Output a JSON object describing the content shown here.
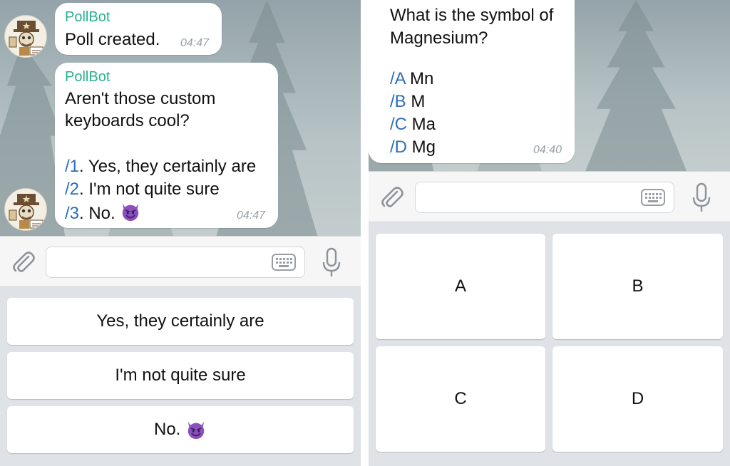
{
  "left": {
    "messages": [
      {
        "sender": "PollBot",
        "lines": [
          "Poll created."
        ],
        "time": "04:47"
      },
      {
        "sender": "PollBot",
        "question_lines": [
          "Aren't those custom",
          "keyboards cool?"
        ],
        "options": [
          {
            "cmd": "/1",
            "text": ". Yes, they certainly are"
          },
          {
            "cmd": "/2",
            "text": ". I'm not quite sure"
          },
          {
            "cmd": "/3",
            "text": ". No. ",
            "emoji": "smiling-imp"
          }
        ],
        "time": "04:47"
      }
    ],
    "keyboard": [
      {
        "label": "Yes, they certainly are"
      },
      {
        "label": "I'm not quite sure"
      },
      {
        "label": "No. ",
        "emoji": "smiling-imp"
      }
    ]
  },
  "right": {
    "message": {
      "question_lines": [
        "What is the symbol of",
        "Magnesium?"
      ],
      "options": [
        {
          "cmd": "/A",
          "text": " Mn"
        },
        {
          "cmd": "/B",
          "text": " M"
        },
        {
          "cmd": "/C",
          "text": " Ma"
        },
        {
          "cmd": "/D",
          "text": " Mg"
        }
      ],
      "time": "04:40"
    },
    "keyboard": [
      {
        "label": "A"
      },
      {
        "label": "B"
      },
      {
        "label": "C"
      },
      {
        "label": "D"
      }
    ]
  },
  "icons": {
    "attach": "paperclip-icon",
    "keyboard": "keyboard-icon",
    "microphone": "microphone-icon",
    "avatar": "pollbot-avatar",
    "emoji": "smiling-imp-emoji"
  },
  "colors": {
    "sender": "#2bae91",
    "command": "#2d6fb8",
    "timestamp": "#9aa0a6",
    "keyboard_bg": "#dfe2e6",
    "emoji_purple": "#8c4fc0"
  }
}
